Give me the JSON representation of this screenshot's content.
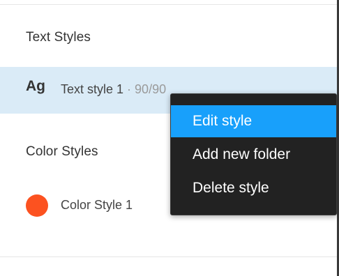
{
  "text_styles": {
    "header": "Text Styles",
    "items": [
      {
        "preview": "Ag",
        "name": "Text style 1",
        "meta": " · 90/90"
      }
    ]
  },
  "color_styles": {
    "header": "Color Styles",
    "items": [
      {
        "name": "Color Style 1",
        "color": "#fc5220"
      }
    ]
  },
  "context_menu": {
    "items": [
      {
        "label": "Edit style",
        "highlighted": true
      },
      {
        "label": "Add new folder"
      },
      {
        "label": "Delete style"
      }
    ]
  },
  "colors": {
    "selection": "#daebf7",
    "menu_background": "#222222",
    "menu_highlight": "#18a0fb"
  }
}
